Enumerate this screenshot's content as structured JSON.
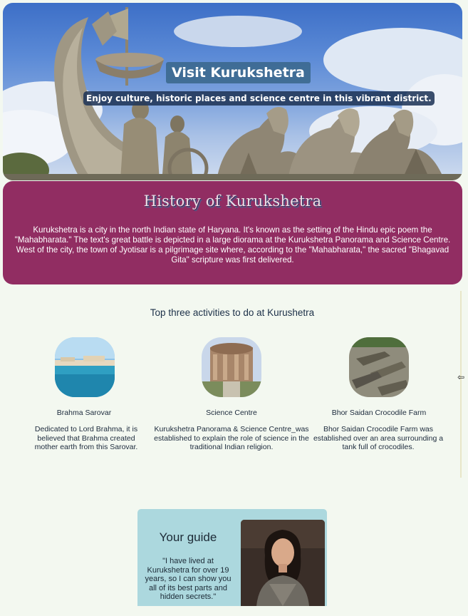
{
  "hero": {
    "title": "Visit Kurukshetra",
    "subtitle": "Enjoy culture, historic places and science centre in this vibrant district.",
    "image": "chariot-monument-photo"
  },
  "history": {
    "title": "History of Kurukshetra",
    "text": "Kurukshetra is a city in the north Indian state of Haryana. It's known as the setting of the Hindu epic poem the \"Mahabharata.\" The text's great battle is depicted in a large diorama at the Kurukshetra Panorama and Science Centre. West of the city, the town of Jyotisar is a pilgrimage site where, according to the \"Mahabharata,\" the sacred \"Bhagavad Gita\" scripture was first delivered."
  },
  "activities": {
    "heading": "Top three activities to do at Kurushetra",
    "items": [
      {
        "name": "Brahma Sarovar",
        "description": "Dedicated to Lord Brahma, it is believed that Brahma created mother earth from this Sarovar.",
        "image": "lake-photo"
      },
      {
        "name": "Science Centre",
        "description": "Kurukshetra Panorama & Science Centre_was established to explain the role of science in the traditional Indian religion.",
        "image": "domed-building-photo"
      },
      {
        "name": "Bhor Saidan Crocodile Farm",
        "description": "Bhor Saidan Crocodile Farm was established over an area surrounding a tank full of crocodiles.",
        "image": "crocodiles-photo"
      }
    ]
  },
  "guide": {
    "title": "Your guide",
    "quote": "\"I have lived at Kurukshetra for over 19 years, so I can show you all of its best parts and hidden secrets.\"",
    "image": "guide-portrait-photo"
  },
  "colors": {
    "page_background": "#f3f8f0",
    "history_background": "#912d62",
    "guide_background": "#acd8de",
    "hero_title_background": "#3a688c",
    "hero_subtitle_background": "#203658"
  }
}
